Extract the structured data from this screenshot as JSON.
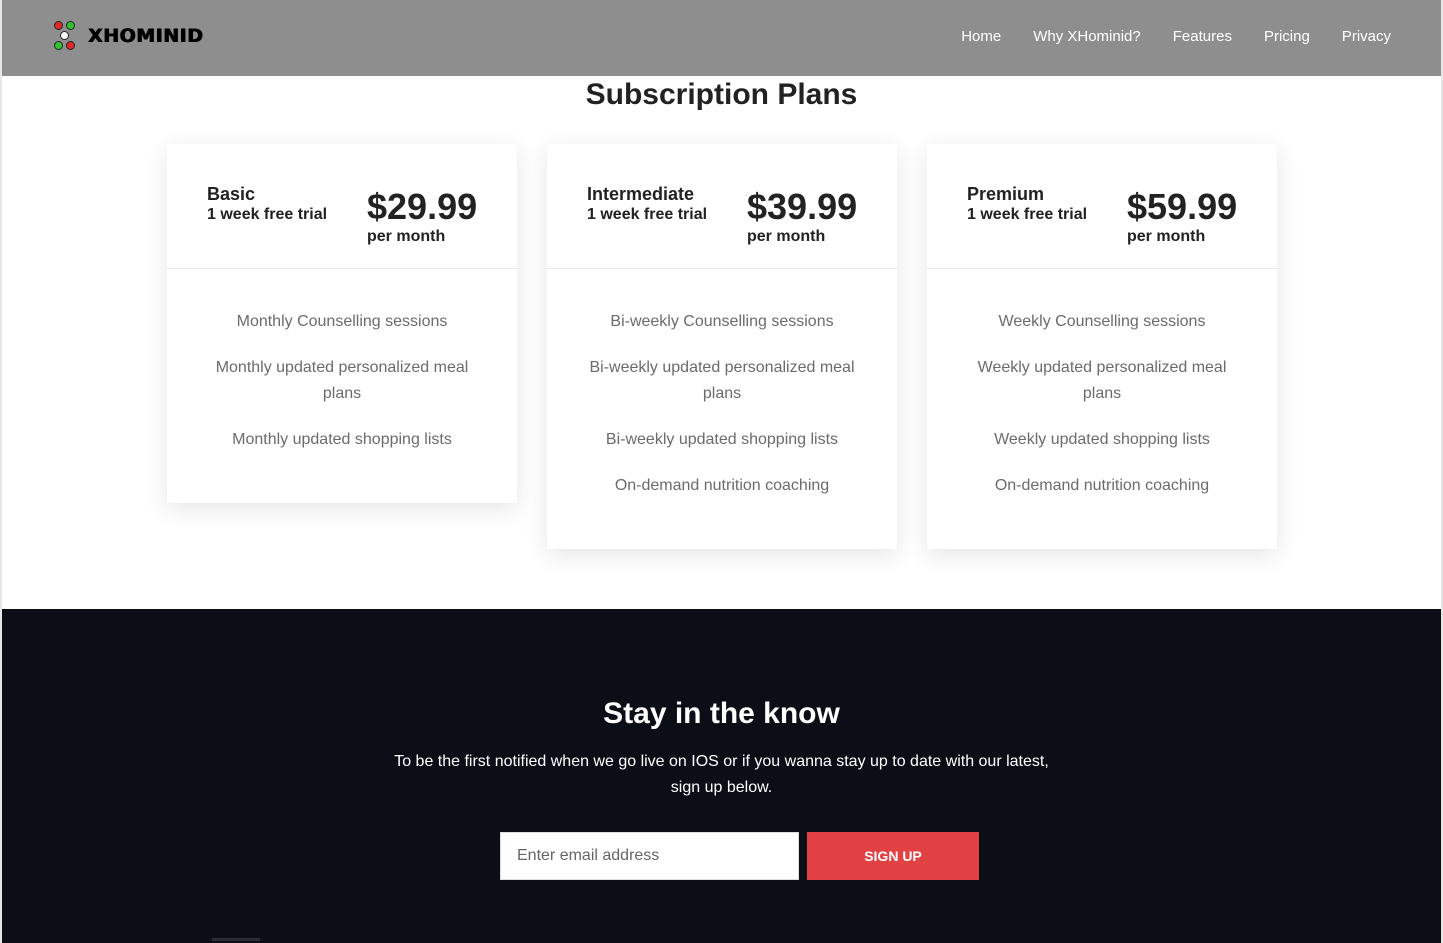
{
  "header": {
    "brand": "XHOMINID",
    "nav": [
      "Home",
      "Why XHominid?",
      "Features",
      "Pricing",
      "Privacy"
    ]
  },
  "pricing": {
    "title": "Subscription Plans",
    "plans": [
      {
        "name": "Basic",
        "trial": "1 week free trial",
        "price": "$29.99",
        "period": "per month",
        "features": [
          "Monthly Counselling sessions",
          "Monthly updated personalized meal plans",
          "Monthly updated shopping lists"
        ]
      },
      {
        "name": "Intermediate",
        "trial": "1 week free trial",
        "price": "$39.99",
        "period": "per month",
        "features": [
          "Bi-weekly Counselling sessions",
          "Bi-weekly updated personalized meal plans",
          "Bi-weekly updated shopping lists",
          "On-demand nutrition coaching"
        ]
      },
      {
        "name": "Premium",
        "trial": "1 week free trial",
        "price": "$59.99",
        "period": "per month",
        "features": [
          "Weekly Counselling sessions",
          "Weekly updated personalized meal plans",
          "Weekly updated shopping lists",
          "On-demand nutrition coaching"
        ]
      }
    ]
  },
  "newsletter": {
    "title": "Stay in the know",
    "text": "To be the first notified when we go live on IOS or if you wanna stay up to date with our latest, sign up below.",
    "email_placeholder": "Enter email address",
    "button": "SIGN UP"
  },
  "colors": {
    "header_bg": "#8e8e8e",
    "newsletter_bg": "#0b0d17",
    "accent": "#e24144",
    "logo_green": "#2fc52f",
    "logo_red": "#e0282a"
  }
}
